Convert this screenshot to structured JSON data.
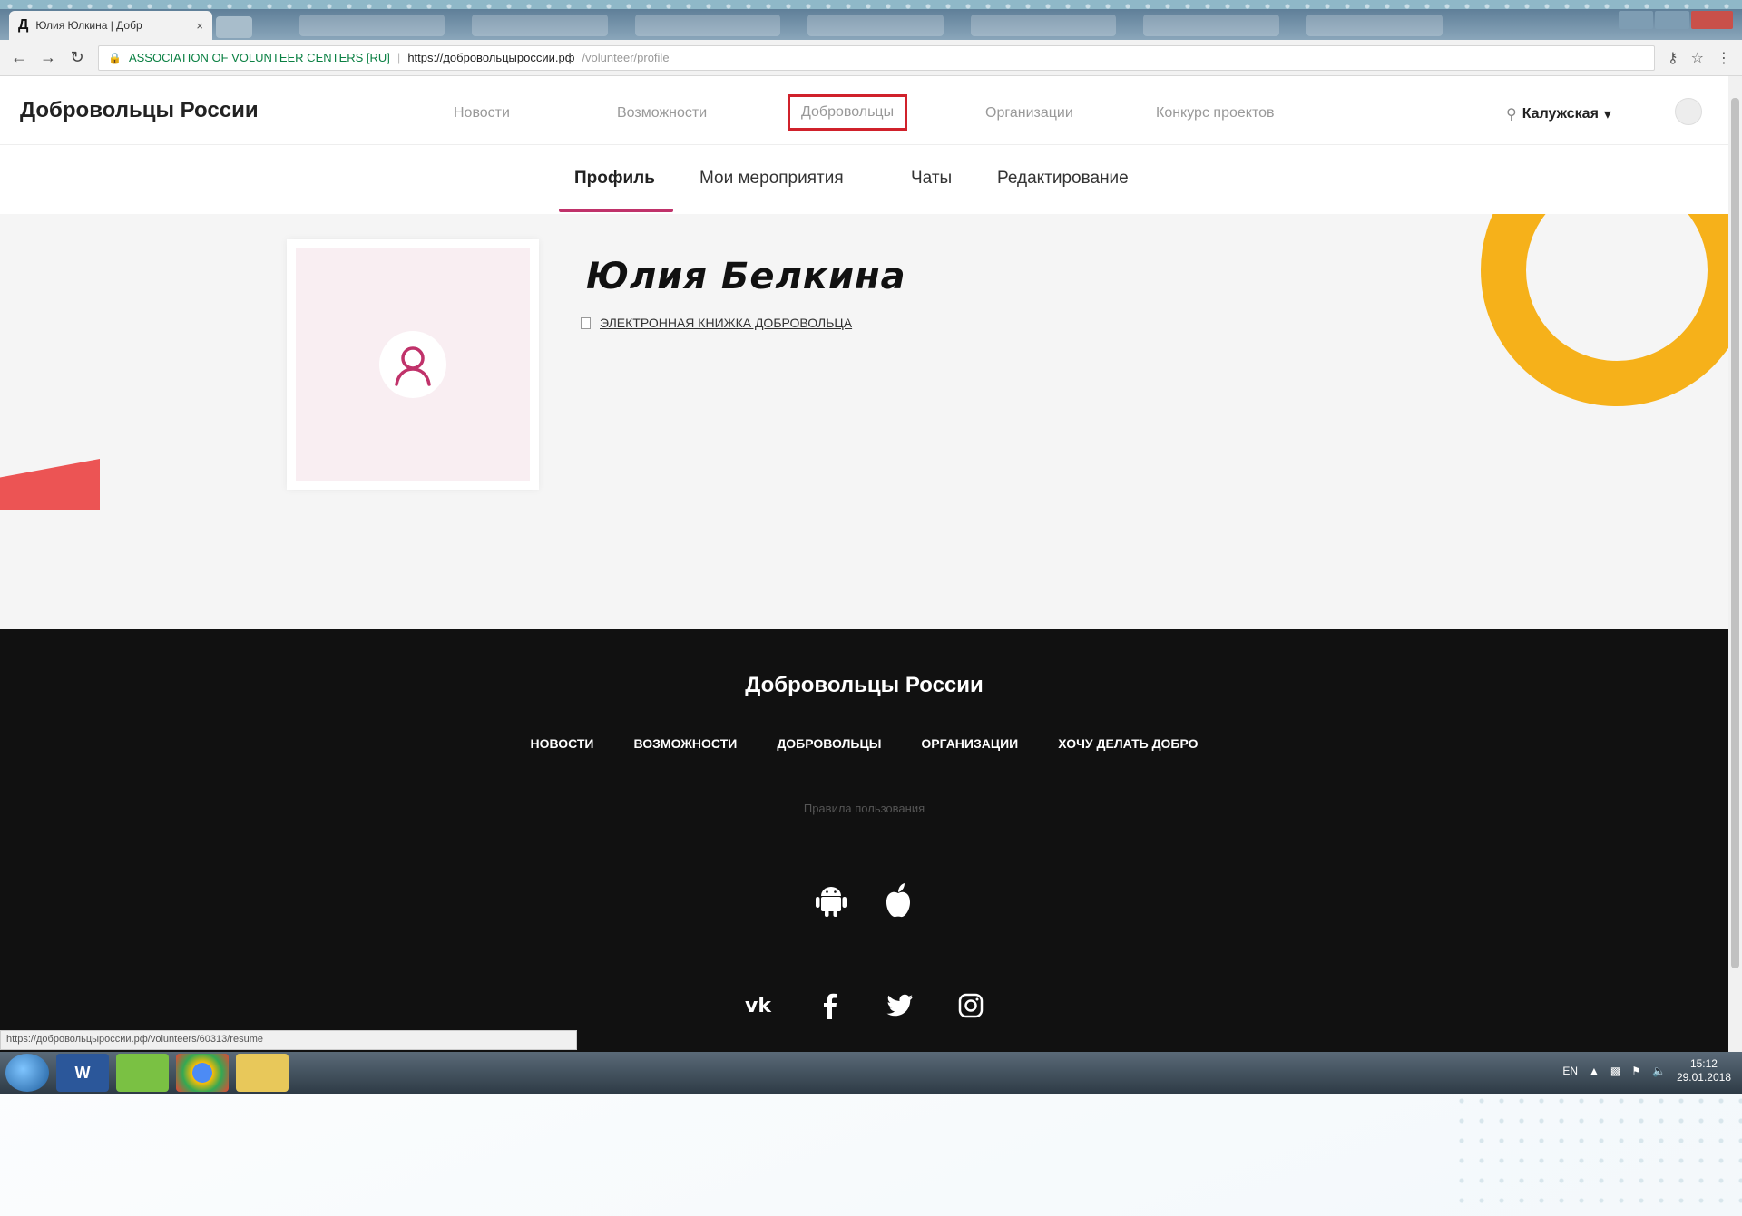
{
  "browser": {
    "tab_title": "Юлия Юлкина | Добр",
    "tab_favicon": "Д",
    "tab_close": "×",
    "cert_name": "ASSOCIATION OF VOLUNTEER CENTERS [RU]",
    "url_host": "https://добровольцыроссии.рф",
    "url_path": "/volunteer/profile"
  },
  "site": {
    "logo": "Добровольцы России",
    "nav": {
      "news": "Новости",
      "opportunities": "Возможности",
      "volunteers": "Добровольцы",
      "organizations": "Организации",
      "contest": "Конкурс проектов"
    },
    "region": "Калужская"
  },
  "profile_tabs": {
    "profile": "Профиль",
    "my_events": "Мои мероприятия",
    "chats": "Чаты",
    "edit": "Редактирование"
  },
  "profile": {
    "name": "Юлия Белкина",
    "ebook_link": "ЭЛЕКТРОННАЯ КНИЖКА ДОБРОВОЛЬЦА"
  },
  "footer": {
    "brand": "Добровольцы России",
    "nav": {
      "news": "НОВОСТИ",
      "opportunities": "ВОЗМОЖНОСТИ",
      "volunteers": "ДОБРОВОЛЬЦЫ",
      "organizations": "ОРГАНИЗАЦИИ",
      "do_good": "ХОЧУ ДЕЛАТЬ ДОБРО"
    },
    "rules": "Правила пользования"
  },
  "status_bar": {
    "url": "https://добровольцыроссии.рф/volunteers/60313/resume"
  },
  "taskbar": {
    "word_label": "W",
    "lang": "EN",
    "time": "15:12",
    "date": "29.01.2018"
  },
  "colors": {
    "accent_pink": "#c0326a",
    "highlight_red": "#d0212b",
    "ring_yellow": "#f6b11a",
    "shape_red": "#ec5454",
    "footer_bg": "#111111"
  }
}
